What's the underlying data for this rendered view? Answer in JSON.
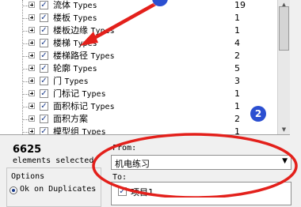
{
  "tree": {
    "items": [
      {
        "label_cn": "流体",
        "label_en": "Types",
        "count": "19",
        "checked": true
      },
      {
        "label_cn": "楼板",
        "label_en": "Types",
        "count": "1",
        "checked": true
      },
      {
        "label_cn": "楼板边缘",
        "label_en": "Types",
        "count": "1",
        "checked": true
      },
      {
        "label_cn": "楼梯",
        "label_en": "Types",
        "count": "4",
        "checked": true
      },
      {
        "label_cn": "楼梯路径",
        "label_en": "Types",
        "count": "2",
        "checked": true
      },
      {
        "label_cn": "轮廓",
        "label_en": "Types",
        "count": "5",
        "checked": true
      },
      {
        "label_cn": "门",
        "label_en": "Types",
        "count": "3",
        "checked": true
      },
      {
        "label_cn": "门标记",
        "label_en": "Types",
        "count": "1",
        "checked": true
      },
      {
        "label_cn": "面积标记",
        "label_en": "Types",
        "count": "1",
        "checked": true
      },
      {
        "label_cn": "面积方案",
        "label_en": "",
        "count": "2",
        "checked": true
      },
      {
        "label_cn": "模型组",
        "label_en": "Types",
        "count": "1",
        "checked": true
      }
    ]
  },
  "summary": {
    "count": "6625",
    "caption": "elements selected"
  },
  "options": {
    "caption": "Options",
    "radio_label": "Ok on Duplicates"
  },
  "from": {
    "caption": "From:",
    "value": "机电练习"
  },
  "to": {
    "caption": "To:",
    "item": "项目1"
  },
  "annotations": {
    "badge_1": "",
    "badge_2": "2",
    "color": "#e3201b"
  }
}
